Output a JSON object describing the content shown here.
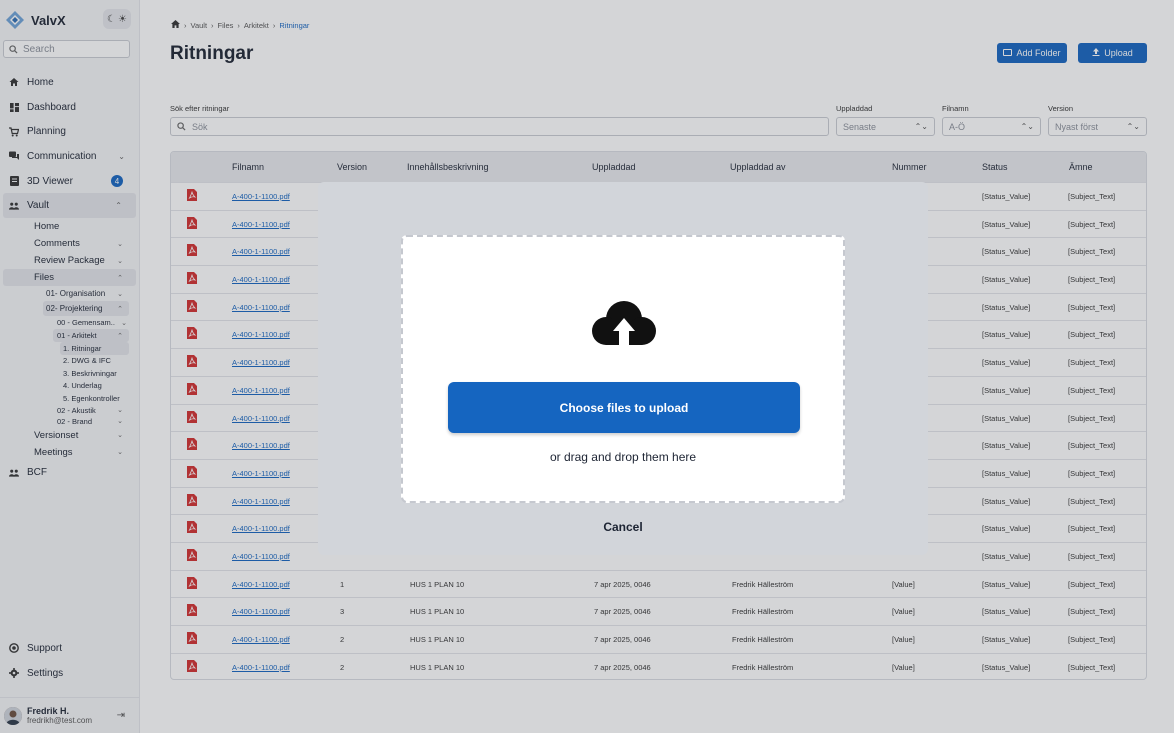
{
  "app": {
    "name": "ValvX"
  },
  "sidebar": {
    "search_placeholder": "Search",
    "items": [
      {
        "label": "Home",
        "icon": "home-icon"
      },
      {
        "label": "Dashboard",
        "icon": "dashboard-icon"
      },
      {
        "label": "Planning",
        "icon": "cart-icon"
      },
      {
        "label": "Communication",
        "icon": "chat-icon"
      },
      {
        "label": "3D Viewer",
        "icon": "viewer-icon",
        "badge": "4"
      },
      {
        "label": "Vault",
        "icon": "people-icon"
      }
    ],
    "vault_sub": {
      "home": "Home",
      "comments": "Comments",
      "review": "Review Package",
      "files": "Files",
      "org": "01- Organisation",
      "proj": "02- Projektering",
      "gemensam": "00 - Gemensam..",
      "arkitekt": "01 - Arkitekt",
      "ritningar": "1. Ritningar",
      "dwg": "2. DWG & IFC",
      "beskriv": "3. Beskrivningar",
      "underlag": "4. Underlag",
      "egen": "5. Egenkontroller",
      "akustik": "02 - Akustik",
      "brand": "02 - Brand",
      "versionset": "Versionset",
      "meetings": "Meetings"
    },
    "bcf": "BCF",
    "support": "Support",
    "settings": "Settings",
    "user": {
      "name": "Fredrik H.",
      "email": "fredrikh@test.com"
    }
  },
  "breadcrumb": [
    "Vault",
    "Files",
    "Arkitekt",
    "Ritningar"
  ],
  "page": {
    "title": "Ritningar",
    "add_folder": "Add Folder",
    "upload": "Upload"
  },
  "filters": {
    "search_label": "Sök efter ritningar",
    "search_placeholder": "Sök",
    "uppladdad_label": "Uppladdad",
    "uppladdad_value": "Senaste",
    "filnamn_label": "Filnamn",
    "filnamn_value": "A-Ö",
    "version_label": "Version",
    "version_value": "Nyast först"
  },
  "table": {
    "headers": [
      "Filnamn",
      "Version",
      "Innehållsbeskrivning",
      "Uppladdad",
      "Uppladdad av",
      "Nummer",
      "Status",
      "Ämne"
    ],
    "rows": [
      {
        "file": "A-400-1-1100.pdf",
        "version": "",
        "desc": "",
        "date": "",
        "by": "",
        "num": "",
        "status": "[Status_Value]",
        "subject": "[Subject_Text]"
      },
      {
        "file": "A-400-1-1100.pdf",
        "version": "",
        "desc": "",
        "date": "",
        "by": "",
        "num": "",
        "status": "[Status_Value]",
        "subject": "[Subject_Text]"
      },
      {
        "file": "A-400-1-1100.pdf",
        "version": "",
        "desc": "",
        "date": "",
        "by": "",
        "num": "",
        "status": "[Status_Value]",
        "subject": "[Subject_Text]"
      },
      {
        "file": "A-400-1-1100.pdf",
        "version": "",
        "desc": "",
        "date": "",
        "by": "",
        "num": "",
        "status": "[Status_Value]",
        "subject": "[Subject_Text]"
      },
      {
        "file": "A-400-1-1100.pdf",
        "version": "",
        "desc": "",
        "date": "",
        "by": "",
        "num": "",
        "status": "[Status_Value]",
        "subject": "[Subject_Text]"
      },
      {
        "file": "A-400-1-1100.pdf",
        "version": "",
        "desc": "",
        "date": "",
        "by": "",
        "num": "",
        "status": "[Status_Value]",
        "subject": "[Subject_Text]"
      },
      {
        "file": "A-400-1-1100.pdf",
        "version": "",
        "desc": "",
        "date": "",
        "by": "",
        "num": "",
        "status": "[Status_Value]",
        "subject": "[Subject_Text]"
      },
      {
        "file": "A-400-1-1100.pdf",
        "version": "",
        "desc": "",
        "date": "",
        "by": "",
        "num": "",
        "status": "[Status_Value]",
        "subject": "[Subject_Text]"
      },
      {
        "file": "A-400-1-1100.pdf",
        "version": "",
        "desc": "",
        "date": "",
        "by": "",
        "num": "",
        "status": "[Status_Value]",
        "subject": "[Subject_Text]"
      },
      {
        "file": "A-400-1-1100.pdf",
        "version": "",
        "desc": "",
        "date": "",
        "by": "",
        "num": "",
        "status": "[Status_Value]",
        "subject": "[Subject_Text]"
      },
      {
        "file": "A-400-1-1100.pdf",
        "version": "",
        "desc": "",
        "date": "",
        "by": "",
        "num": "",
        "status": "[Status_Value]",
        "subject": "[Subject_Text]"
      },
      {
        "file": "A-400-1-1100.pdf",
        "version": "",
        "desc": "",
        "date": "",
        "by": "",
        "num": "",
        "status": "[Status_Value]",
        "subject": "[Subject_Text]"
      },
      {
        "file": "A-400-1-1100.pdf",
        "version": "",
        "desc": "",
        "date": "",
        "by": "",
        "num": "",
        "status": "[Status_Value]",
        "subject": "[Subject_Text]"
      },
      {
        "file": "A-400-1-1100.pdf",
        "version": "",
        "desc": "",
        "date": "",
        "by": "",
        "num": "",
        "status": "[Status_Value]",
        "subject": "[Subject_Text]"
      },
      {
        "file": "A-400-1-1100.pdf",
        "version": "1",
        "desc": "HUS 1 PLAN 10",
        "date": "7 apr 2025, 0046",
        "by": "Fredrik Hälleström",
        "num": "[Value]",
        "status": "[Status_Value]",
        "subject": "[Subject_Text]"
      },
      {
        "file": "A-400-1-1100.pdf",
        "version": "3",
        "desc": "HUS 1 PLAN 10",
        "date": "7 apr 2025, 0046",
        "by": "Fredrik Hälleström",
        "num": "[Value]",
        "status": "[Status_Value]",
        "subject": "[Subject_Text]"
      },
      {
        "file": "A-400-1-1100.pdf",
        "version": "2",
        "desc": "HUS 1 PLAN 10",
        "date": "7 apr 2025, 0046",
        "by": "Fredrik Hälleström",
        "num": "[Value]",
        "status": "[Status_Value]",
        "subject": "[Subject_Text]"
      },
      {
        "file": "A-400-1-1100.pdf",
        "version": "2",
        "desc": "HUS 1 PLAN 10",
        "date": "7 apr 2025, 0046",
        "by": "Fredrik Hälleström",
        "num": "[Value]",
        "status": "[Status_Value]",
        "subject": "[Subject_Text]"
      }
    ]
  },
  "upload_modal": {
    "choose": "Choose files to upload",
    "drag": "or drag and drop them here",
    "cancel": "Cancel"
  },
  "colors": {
    "accent": "#1565c0",
    "pdf": "#d32f2f"
  }
}
